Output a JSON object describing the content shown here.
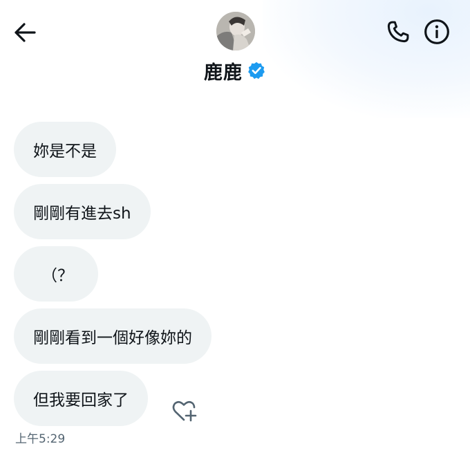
{
  "header": {
    "contact_name": "鹿鹿",
    "verified_icon": "verified-badge-icon",
    "back_icon": "arrow-left-icon",
    "call_icon": "phone-icon",
    "info_icon": "info-icon",
    "accent": "#1d9bf0"
  },
  "messages": [
    {
      "text": "妳是不是"
    },
    {
      "text": "剛剛有進去sh"
    },
    {
      "text": "（？"
    },
    {
      "text": "剛剛看到一個好像妳的"
    },
    {
      "text": "但我要回家了"
    }
  ],
  "reaction_icon": "heart-plus-icon",
  "timestamp": "上午5:29"
}
